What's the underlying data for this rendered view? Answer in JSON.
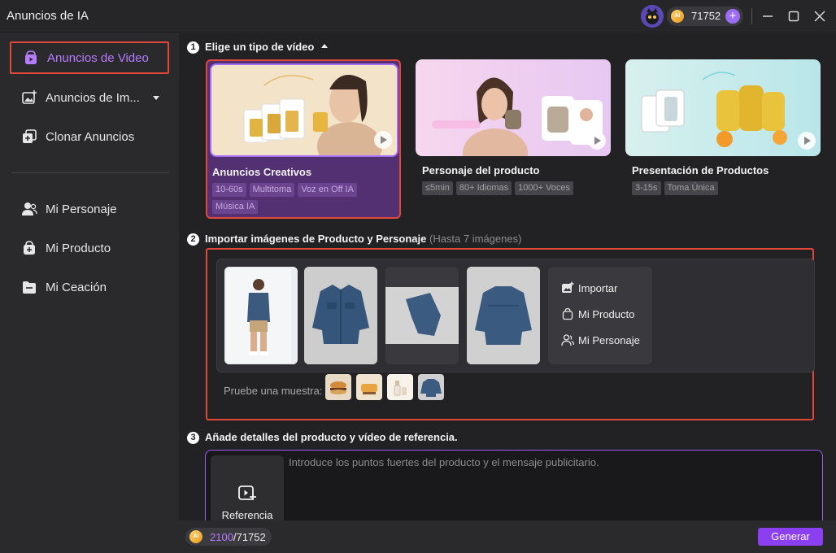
{
  "app": {
    "title": "Anuncios de IA",
    "credits": "71752",
    "coin_text": "AI"
  },
  "sidebar": {
    "items": [
      {
        "label": "Anuncios de Video",
        "icon": "video-bag-icon",
        "active": true
      },
      {
        "label": "Anuncios de Im...",
        "icon": "image-ad-icon"
      },
      {
        "label": "Clonar Anuncios",
        "icon": "clone-icon"
      },
      {
        "label": "Mi Personaje",
        "icon": "person-icon"
      },
      {
        "label": "Mi Producto",
        "icon": "product-bag-icon"
      },
      {
        "label": "Mi Ceación",
        "icon": "folder-icon"
      }
    ]
  },
  "step1": {
    "num": "1",
    "label": "Elige un tipo de vídeo",
    "cards": [
      {
        "title": "Anuncios Creativos",
        "tags": [
          "10-60s",
          "Multitoma",
          "Voz en Off IA",
          "Música IA"
        ],
        "selected": true
      },
      {
        "title": "Personaje del producto",
        "tags": [
          "≤5min",
          "80+ Idiomas",
          "1000+ Voces"
        ]
      },
      {
        "title": "Presentación de Productos",
        "tags": [
          "3-15s",
          "Toma Única"
        ]
      }
    ]
  },
  "step2": {
    "num": "2",
    "label": "Importar imágenes de Producto y Personaje",
    "hint": "(Hasta 7 imágenes)",
    "actions": {
      "import": "Importar",
      "product": "Mi Producto",
      "character": "Mi Personaje"
    },
    "sample_label": "Pruebe una muestra:"
  },
  "step3": {
    "num": "3",
    "label": "Añade detalles del producto y vídeo de referencia.",
    "reference_label": "Referencia",
    "placeholder": "Introduce los puntos fuertes del producto y el mensaje publicitario."
  },
  "footer": {
    "cost": "2100",
    "total": "/71752",
    "generate": "Generar"
  },
  "colors": {
    "accent": "#8c3ff0",
    "highlight": "#e0483a",
    "active_text": "#b67bff"
  }
}
